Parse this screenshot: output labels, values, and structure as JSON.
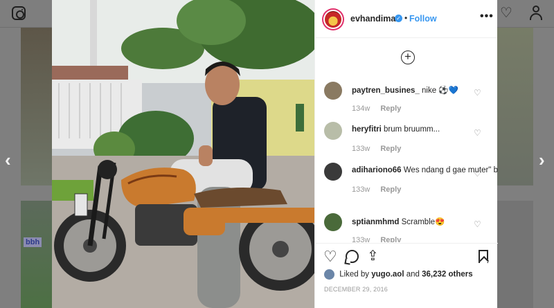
{
  "colors": {
    "accent": "#3897f0",
    "story_ring": "#e1306c",
    "muted": "#999999"
  },
  "background": {
    "tag_text": "bbh"
  },
  "top_bar": {
    "logo_icon": "instagram-icon",
    "activity_icon": "heart-icon",
    "profile_icon": "user-icon"
  },
  "navigation": {
    "prev": "‹",
    "next": "›"
  },
  "post": {
    "header": {
      "username": "evhandimas",
      "separator": "•",
      "follow_label": "Follow",
      "more_label": "•••"
    },
    "load_more": "+",
    "comments": [
      {
        "user": "paytren_busines_",
        "text": "nike ⚽💙",
        "age": "134w",
        "reply": "Reply",
        "avatar_color": "#8a7a62"
      },
      {
        "user": "heryfitri",
        "text": "brum bruumm...",
        "age": "133w",
        "reply": "Reply",
        "avatar_color": "#b8bda8"
      },
      {
        "user": "adihariono66",
        "text": "Wes ndang d gae muter\" bro",
        "age": "133w",
        "reply": "Reply",
        "avatar_color": "#3a3a3a"
      },
      {
        "user": "sptianmhmd",
        "text": "Scramble😍",
        "age": "133w",
        "reply": "Reply",
        "avatar_color": "#4a6a3a"
      }
    ],
    "likes": {
      "prefix": "Liked by",
      "user": "yugo.aol",
      "joiner": "and",
      "others": "36,232 others"
    },
    "date": "DECEMBER 29, 2016"
  }
}
